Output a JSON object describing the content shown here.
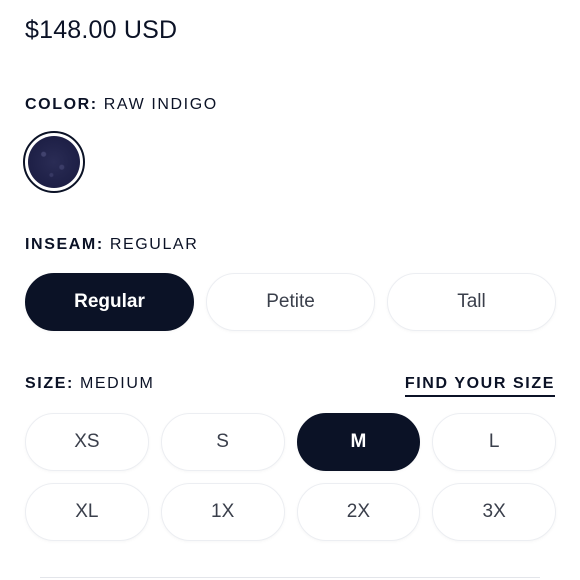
{
  "price": "$148.00 USD",
  "color": {
    "key": "COLOR:",
    "value": "RAW INDIGO",
    "swatch_name": "Raw Indigo"
  },
  "inseam": {
    "key": "INSEAM:",
    "value": "REGULAR",
    "options": [
      "Regular",
      "Petite",
      "Tall"
    ],
    "selected": "Regular"
  },
  "size": {
    "key": "SIZE:",
    "value": "MEDIUM",
    "find_link": "FIND YOUR SIZE",
    "options": [
      "XS",
      "S",
      "M",
      "L",
      "XL",
      "1X",
      "2X",
      "3X"
    ],
    "selected": "M"
  },
  "colors": {
    "primary": "#0b1226",
    "swatch": "#1f2148",
    "background": "#ffffff"
  }
}
